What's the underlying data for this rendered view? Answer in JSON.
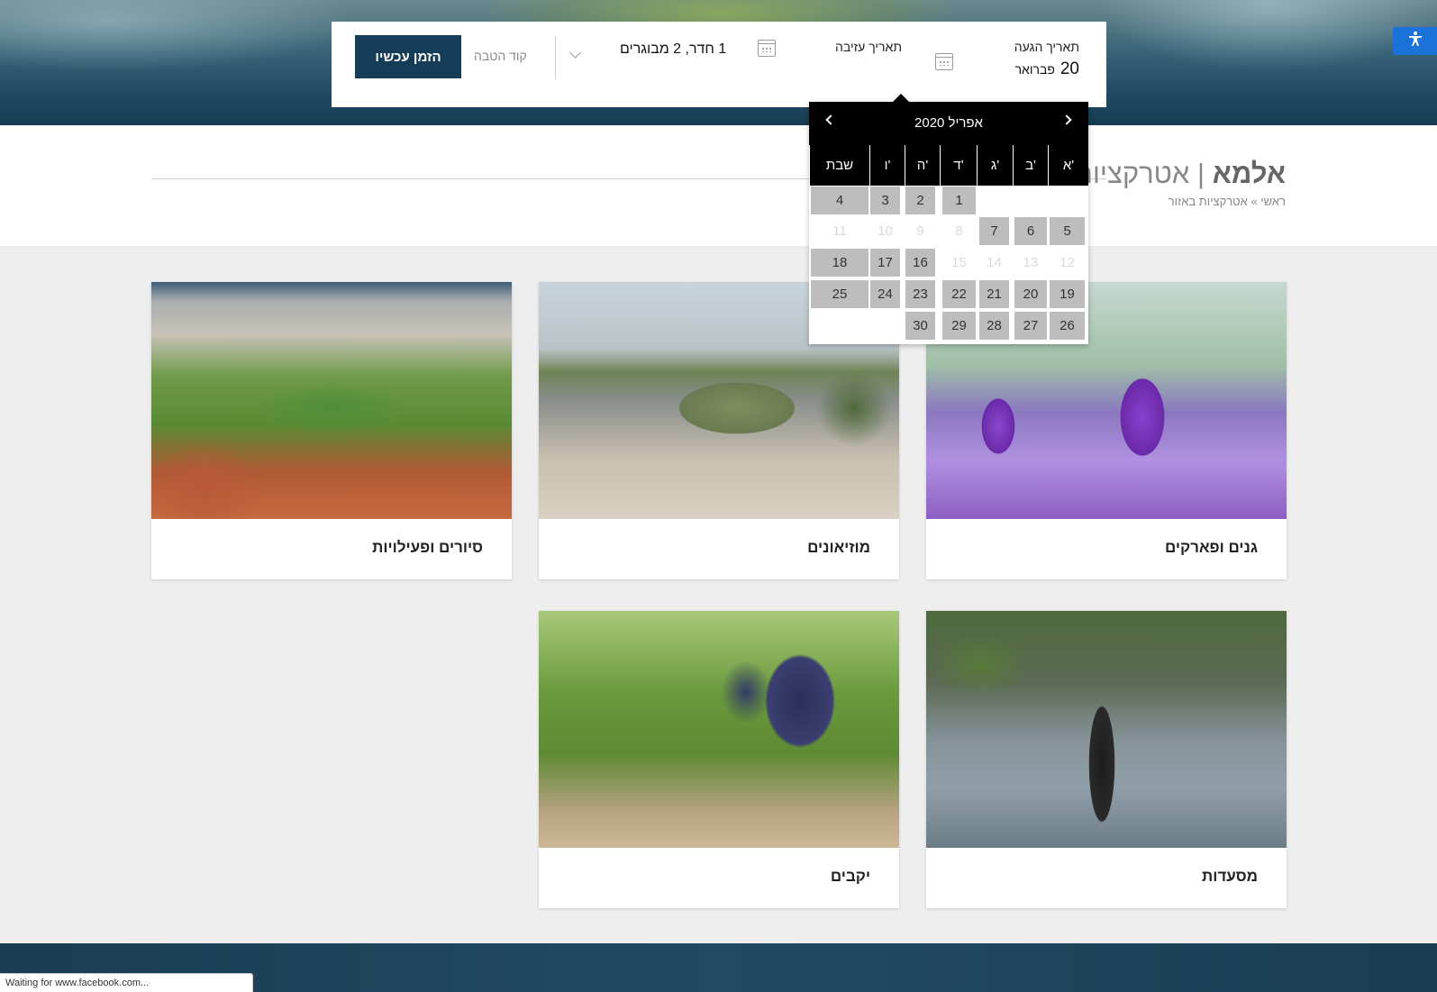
{
  "booking": {
    "arrival_label": "תאריך הגעה",
    "arrival_day": "20",
    "arrival_month": "פברואר",
    "departure_label": "תאריך עזיבה",
    "guests": "1 חדר, 2 מבוגרים",
    "promo_placeholder": "קוד הטבה",
    "book_label": "הזמן עכשיו"
  },
  "page": {
    "brand": "אלמא",
    "separator": "|",
    "title": "אטרקציות באזור",
    "breadcrumb": "ראשי » אטרקציות באזור"
  },
  "calendar": {
    "month_label": "אפריל 2020",
    "weekdays": [
      "א'",
      "ב'",
      "ג'",
      "ד'",
      "ה'",
      "ו'",
      "שבת"
    ],
    "weeks": [
      [
        {
          "d": "",
          "s": "empty"
        },
        {
          "d": "",
          "s": "empty"
        },
        {
          "d": "",
          "s": "empty"
        },
        {
          "d": "1",
          "s": "on"
        },
        {
          "d": "2",
          "s": "on"
        },
        {
          "d": "3",
          "s": "on"
        },
        {
          "d": "4",
          "s": "on"
        }
      ],
      [
        {
          "d": "5",
          "s": "on"
        },
        {
          "d": "6",
          "s": "on"
        },
        {
          "d": "7",
          "s": "on"
        },
        {
          "d": "8",
          "s": "off"
        },
        {
          "d": "9",
          "s": "off"
        },
        {
          "d": "10",
          "s": "off"
        },
        {
          "d": "11",
          "s": "off"
        }
      ],
      [
        {
          "d": "12",
          "s": "off"
        },
        {
          "d": "13",
          "s": "off"
        },
        {
          "d": "14",
          "s": "off"
        },
        {
          "d": "15",
          "s": "off"
        },
        {
          "d": "16",
          "s": "on"
        },
        {
          "d": "17",
          "s": "on"
        },
        {
          "d": "18",
          "s": "on"
        }
      ],
      [
        {
          "d": "19",
          "s": "on"
        },
        {
          "d": "20",
          "s": "on"
        },
        {
          "d": "21",
          "s": "on"
        },
        {
          "d": "22",
          "s": "on"
        },
        {
          "d": "23",
          "s": "on"
        },
        {
          "d": "24",
          "s": "on"
        },
        {
          "d": "25",
          "s": "on"
        }
      ],
      [
        {
          "d": "26",
          "s": "on"
        },
        {
          "d": "27",
          "s": "on"
        },
        {
          "d": "28",
          "s": "on"
        },
        {
          "d": "29",
          "s": "on"
        },
        {
          "d": "30",
          "s": "on"
        },
        {
          "d": "",
          "s": "empty"
        },
        {
          "d": "",
          "s": "empty"
        }
      ]
    ]
  },
  "cards": [
    {
      "label": "גנים ופארקים",
      "image": "purple-crocus-flowers"
    },
    {
      "label": "מוזיאונים",
      "image": "submarine-museum"
    },
    {
      "label": "סיורים ופעילויות",
      "image": "bahai-gardens-haifa"
    },
    {
      "label": "מסעדות",
      "image": "wine-table-setting"
    },
    {
      "label": "יקבים",
      "image": "vineyard-grapes"
    }
  ],
  "status_bar": "Waiting for www.facebook.com...",
  "colors": {
    "primary": "#163d57",
    "accessibility": "#1b73d9",
    "calendar_header": "#000000",
    "available_day": "#bdbdbd"
  },
  "icons": {
    "accessibility": "accessibility-icon",
    "calendar": "calendar-icon",
    "dropdown": "chevron-down-icon",
    "prev": "chevron-left-icon",
    "next": "chevron-right-icon"
  }
}
